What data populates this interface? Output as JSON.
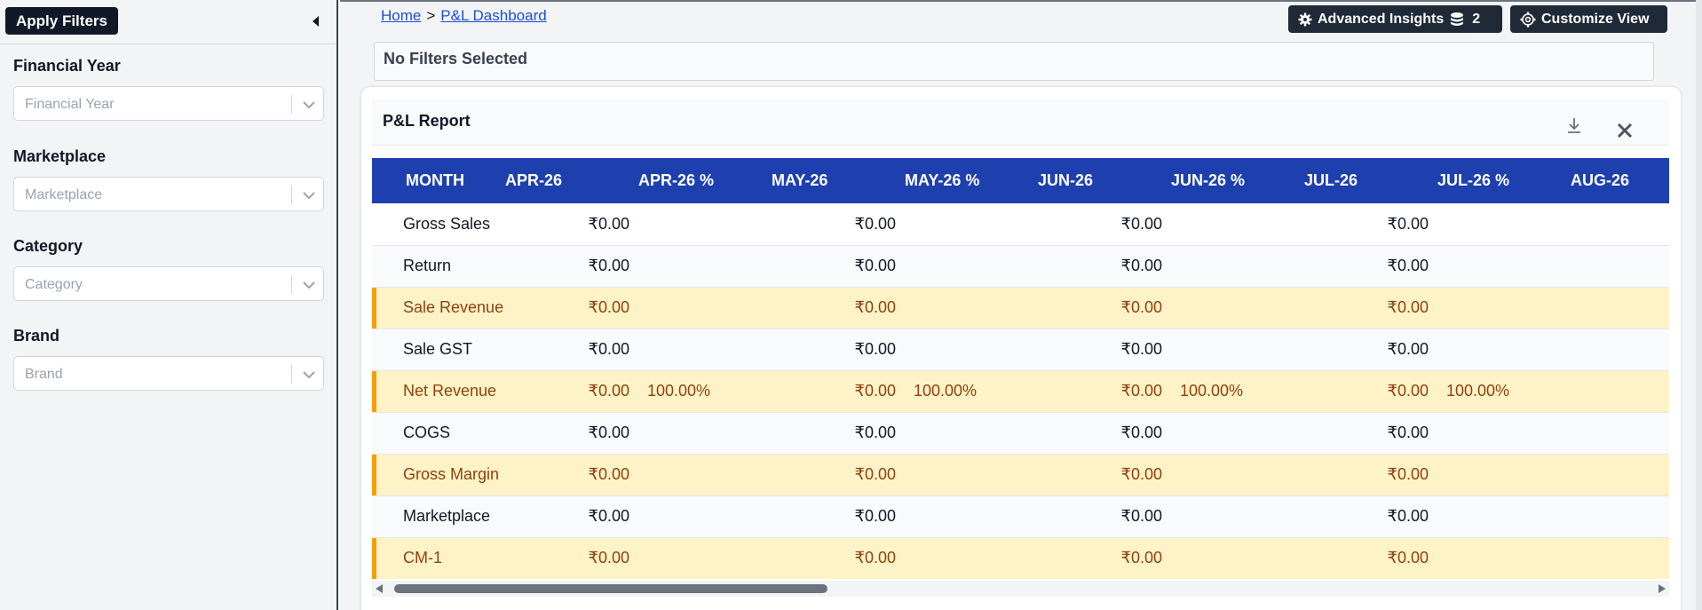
{
  "sidebar": {
    "apply_label": "Apply Filters",
    "collapse_icon": "chevron-left-icon",
    "filters": [
      {
        "label": "Financial Year",
        "placeholder": "Financial Year"
      },
      {
        "label": "Marketplace",
        "placeholder": "Marketplace"
      },
      {
        "label": "Category",
        "placeholder": "Category"
      },
      {
        "label": "Brand",
        "placeholder": "Brand"
      }
    ]
  },
  "breadcrumb": {
    "home": "Home",
    "separator": ">",
    "current": "P&L Dashboard"
  },
  "toolbar": {
    "insights_label": "Advanced Insights",
    "insights_icon": "gear-icon",
    "insights_badge_icon": "coins-icon",
    "insights_count": "2",
    "customize_label": "Customize View",
    "customize_icon": "settings-icon"
  },
  "filter_status": "No Filters Selected",
  "report": {
    "title": "P&L Report",
    "download_icon": "download-icon",
    "close_icon": "close-icon",
    "columns": [
      "MONTH",
      "APR-26",
      "APR-26 %",
      "MAY-26",
      "MAY-26 %",
      "JUN-26",
      "JUN-26 %",
      "JUL-26",
      "JUL-26 %",
      "AUG-26"
    ],
    "rows": [
      {
        "label": "Gross Sales",
        "highlight": false,
        "cells": [
          "₹0.00",
          "",
          "₹0.00",
          "",
          "₹0.00",
          "",
          "₹0.00",
          "",
          ""
        ]
      },
      {
        "label": "Return",
        "highlight": false,
        "cells": [
          "₹0.00",
          "",
          "₹0.00",
          "",
          "₹0.00",
          "",
          "₹0.00",
          "",
          ""
        ]
      },
      {
        "label": "Sale Revenue",
        "highlight": true,
        "cells": [
          "₹0.00",
          "",
          "₹0.00",
          "",
          "₹0.00",
          "",
          "₹0.00",
          "",
          ""
        ]
      },
      {
        "label": "Sale GST",
        "highlight": false,
        "cells": [
          "₹0.00",
          "",
          "₹0.00",
          "",
          "₹0.00",
          "",
          "₹0.00",
          "",
          ""
        ]
      },
      {
        "label": "Net Revenue",
        "highlight": true,
        "cells": [
          "₹0.00",
          "100.00%",
          "₹0.00",
          "100.00%",
          "₹0.00",
          "100.00%",
          "₹0.00",
          "100.00%",
          ""
        ]
      },
      {
        "label": "COGS",
        "highlight": false,
        "cells": [
          "₹0.00",
          "",
          "₹0.00",
          "",
          "₹0.00",
          "",
          "₹0.00",
          "",
          ""
        ]
      },
      {
        "label": "Gross Margin",
        "highlight": true,
        "cells": [
          "₹0.00",
          "",
          "₹0.00",
          "",
          "₹0.00",
          "",
          "₹0.00",
          "",
          ""
        ]
      },
      {
        "label": "Marketplace",
        "highlight": false,
        "cells": [
          "₹0.00",
          "",
          "₹0.00",
          "",
          "₹0.00",
          "",
          "₹0.00",
          "",
          ""
        ]
      },
      {
        "label": "CM-1",
        "highlight": true,
        "cells": [
          "₹0.00",
          "",
          "₹0.00",
          "",
          "₹0.00",
          "",
          "₹0.00",
          "",
          ""
        ]
      }
    ]
  },
  "colors": {
    "header_bg": "#1e40af",
    "highlight_bg": "#fef3c7",
    "highlight_accent": "#f59e0b",
    "highlight_text": "#92400e",
    "button_dark": "#1f2937"
  }
}
